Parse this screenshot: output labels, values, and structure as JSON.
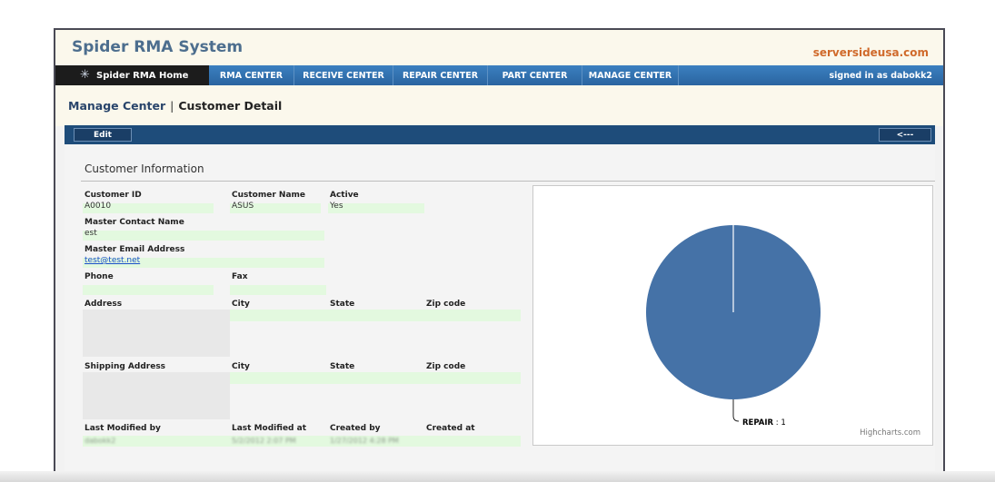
{
  "app": {
    "title": "Spider RMA System",
    "site": "serversideusa.com"
  },
  "nav": {
    "home": "Spider RMA Home",
    "items": [
      "RMA CENTER",
      "RECEIVE CENTER",
      "REPAIR CENTER",
      "PART CENTER",
      "MANAGE CENTER"
    ],
    "signed_in": "signed in as dabokk2"
  },
  "breadcrumb": {
    "parent": "Manage Center",
    "separator": "|",
    "current": "Customer Detail"
  },
  "toolbar": {
    "edit_label": "Edit",
    "back_label": "<---"
  },
  "customer": {
    "section_title": "Customer Information",
    "labels": {
      "id": "Customer ID",
      "name": "Customer Name",
      "active": "Active",
      "master_contact": "Master Contact Name",
      "master_email": "Master Email Address",
      "phone": "Phone",
      "fax": "Fax",
      "address": "Address",
      "city": "City",
      "state": "State",
      "zip": "Zip code",
      "shipping_address": "Shipping Address",
      "last_modified_by": "Last Modified by",
      "last_modified_at": "Last Modified at",
      "created_by": "Created by",
      "created_at": "Created at"
    },
    "values": {
      "id": "A0010",
      "name": "ASUS",
      "active": "Yes",
      "master_contact": "est",
      "master_email": "test@test.net",
      "last_modified_by": "dabokk2",
      "last_modified_at": "5/2/2012 2:07 PM",
      "created_by": "1/27/2012 4:28 PM"
    }
  },
  "chart_data": {
    "type": "pie",
    "categories": [
      "REPAIR"
    ],
    "values": [
      1
    ],
    "labels": [
      {
        "name": "REPAIR",
        "value": "1"
      }
    ],
    "colors": [
      "#4572a7"
    ],
    "credit": "Highcharts.com"
  }
}
